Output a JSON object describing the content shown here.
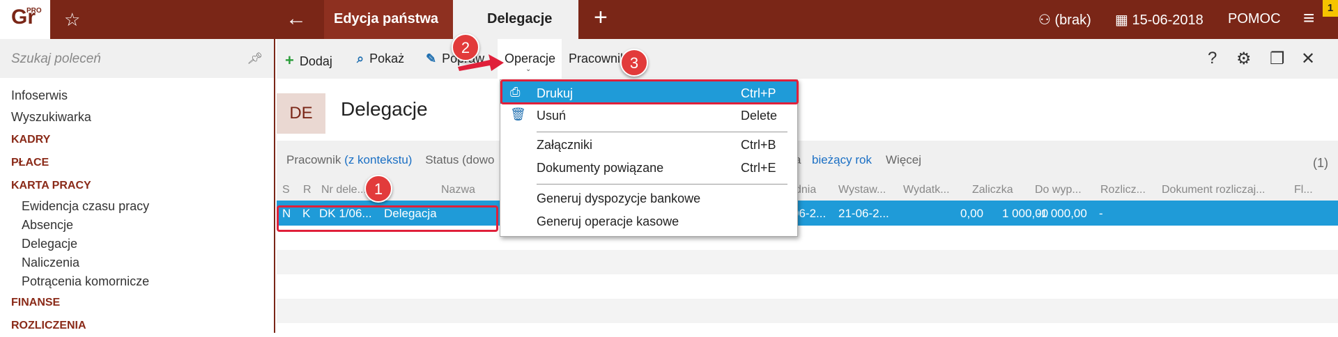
{
  "topbar": {
    "logo": "Gr",
    "logo_sup": "PRO",
    "tab1": "Edycja państwa",
    "tab2": "Delegacje",
    "user": "(brak)",
    "date": "15-06-2018",
    "help": "POMOC",
    "badge": "1"
  },
  "sidebar": {
    "search_placeholder": "Szukaj poleceń",
    "items": [
      {
        "label": "Infoserwis",
        "type": "item"
      },
      {
        "label": "Wyszukiwarka",
        "type": "item"
      },
      {
        "label": "KADRY",
        "type": "head"
      },
      {
        "label": "PŁACE",
        "type": "head"
      },
      {
        "label": "KARTA PRACY",
        "type": "head"
      },
      {
        "label": "Ewidencja czasu pracy",
        "type": "sub"
      },
      {
        "label": "Absencje",
        "type": "sub"
      },
      {
        "label": "Delegacje",
        "type": "sub"
      },
      {
        "label": "Naliczenia",
        "type": "sub"
      },
      {
        "label": "Potrącenia komornicze",
        "type": "sub"
      },
      {
        "label": "FINANSE",
        "type": "head"
      },
      {
        "label": "ROZLICZENIA",
        "type": "head"
      }
    ]
  },
  "toolbar": {
    "add": "Dodaj",
    "show": "Pokaż",
    "edit": "Popraw",
    "operations": "Operacje",
    "employee": "Pracownik"
  },
  "content": {
    "badge": "DE",
    "title": "Delegacje",
    "filter": {
      "employee_label": "Pracownik",
      "employee_value": "(z kontekstu)",
      "status_label": "Status (dowo",
      "period_prefix": "a",
      "period_value": "bieżący rok",
      "more": "Więcej",
      "count": "(1)"
    },
    "columns": [
      "S",
      "R",
      "Nr dele...",
      "Nazwa",
      "dnia",
      "Wystaw...",
      "Wydatk...",
      "Zaliczka",
      "Do wyp...",
      "Rozlicz...",
      "Dokument rozliczaj...",
      "Fl..."
    ],
    "row": {
      "S": "N",
      "R": "K",
      "nr": "DK 1/06...",
      "nazwa": "Delegacja",
      "dnia": "06-2...",
      "wystaw": "21-06-2...",
      "wydatki": "0,00",
      "zaliczka": "1 000,00",
      "do_wyp": "-1 000,00",
      "rozlicz": "-"
    }
  },
  "menu": {
    "items": [
      {
        "label": "Drukuj",
        "shortcut": "Ctrl+P"
      },
      {
        "label": "Usuń",
        "shortcut": "Delete"
      },
      {
        "label": "Załączniki",
        "shortcut": "Ctrl+B"
      },
      {
        "label": "Dokumenty powiązane",
        "shortcut": "Ctrl+E"
      },
      {
        "label": "Generuj dyspozycje bankowe",
        "shortcut": ""
      },
      {
        "label": "Generuj operacje kasowe",
        "shortcut": ""
      }
    ]
  },
  "callouts": [
    "1",
    "2",
    "3"
  ],
  "colors": {
    "brand": "#7a2617",
    "selection": "#1f9bd8",
    "callout": "#e23b3b"
  }
}
